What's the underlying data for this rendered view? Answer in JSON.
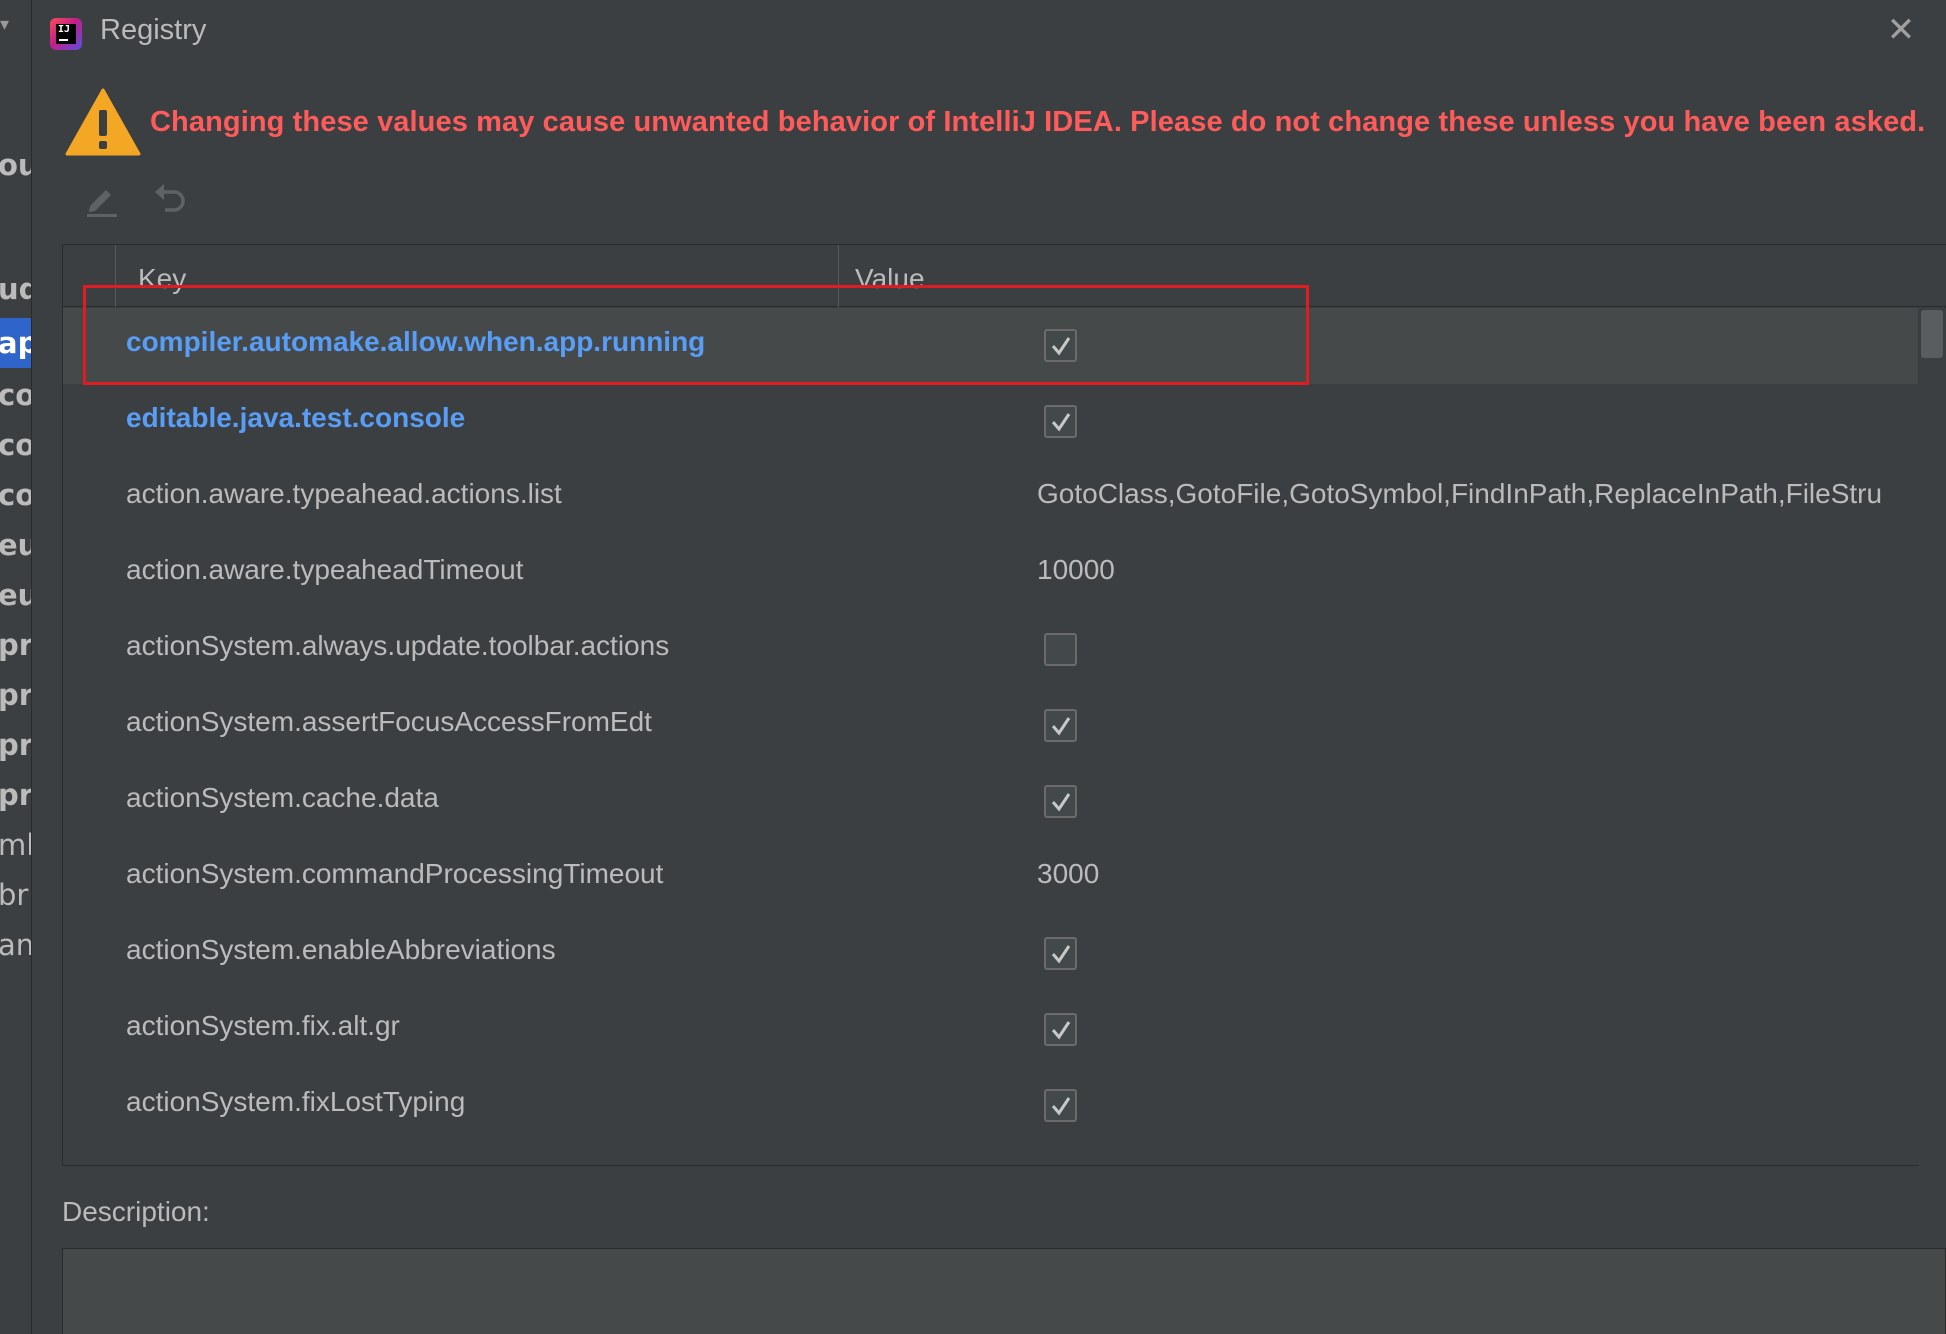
{
  "background": {
    "fragments": [
      "ou",
      "ud",
      "ap",
      "co",
      "co",
      "co",
      "eu",
      "eu",
      "pr",
      "pr",
      "pr",
      "pr",
      "ml",
      "br",
      "an"
    ]
  },
  "dialog": {
    "title": "Registry",
    "close_label": "✕"
  },
  "warning": {
    "text": "Changing these values may cause unwanted behavior of IntelliJ IDEA. Please do not change these unless you have been asked."
  },
  "toolbar": {
    "edit_icon": "pencil-icon",
    "revert_icon": "revert-icon"
  },
  "table": {
    "columns": [
      "Key",
      "Value"
    ],
    "rows": [
      {
        "key": "compiler.automake.allow.when.app.running",
        "type": "checkbox",
        "checked": true,
        "modified": true
      },
      {
        "key": "editable.java.test.console",
        "type": "checkbox",
        "checked": true,
        "modified": true
      },
      {
        "key": "action.aware.typeahead.actions.list",
        "type": "text",
        "value": "GotoClass,GotoFile,GotoSymbol,FindInPath,ReplaceInPath,FileStru",
        "modified": false
      },
      {
        "key": "action.aware.typeaheadTimeout",
        "type": "text",
        "value": "10000",
        "modified": false
      },
      {
        "key": "actionSystem.always.update.toolbar.actions",
        "type": "checkbox",
        "checked": false,
        "modified": false
      },
      {
        "key": "actionSystem.assertFocusAccessFromEdt",
        "type": "checkbox",
        "checked": true,
        "modified": false
      },
      {
        "key": "actionSystem.cache.data",
        "type": "checkbox",
        "checked": true,
        "modified": false
      },
      {
        "key": "actionSystem.commandProcessingTimeout",
        "type": "text",
        "value": "3000",
        "modified": false
      },
      {
        "key": "actionSystem.enableAbbreviations",
        "type": "checkbox",
        "checked": true,
        "modified": false
      },
      {
        "key": "actionSystem.fix.alt.gr",
        "type": "checkbox",
        "checked": true,
        "modified": false
      },
      {
        "key": "actionSystem.fixLostTyping",
        "type": "checkbox",
        "checked": true,
        "modified": false
      }
    ]
  },
  "description": {
    "label": "Description:",
    "text": ""
  },
  "colors": {
    "warning": "#ff5b5b",
    "modified_key": "#589df6",
    "highlight": "#e11b22",
    "background": "#3c3f41"
  }
}
